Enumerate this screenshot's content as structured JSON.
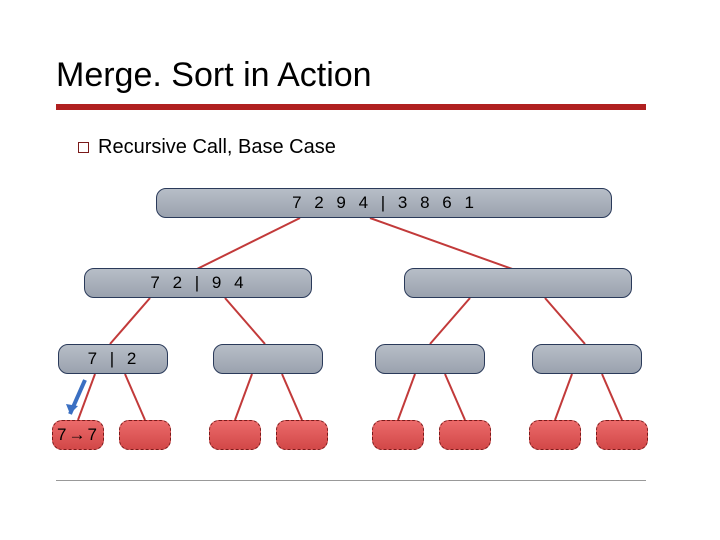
{
  "title": "Merge. Sort in Action",
  "subtitle": "Recursive Call, Base Case",
  "nodes": {
    "root": "7 2 9 4 | 3 8 6 1",
    "l": "7 2 | 9 4",
    "ll": "7 | 2",
    "lll": "7→7"
  }
}
